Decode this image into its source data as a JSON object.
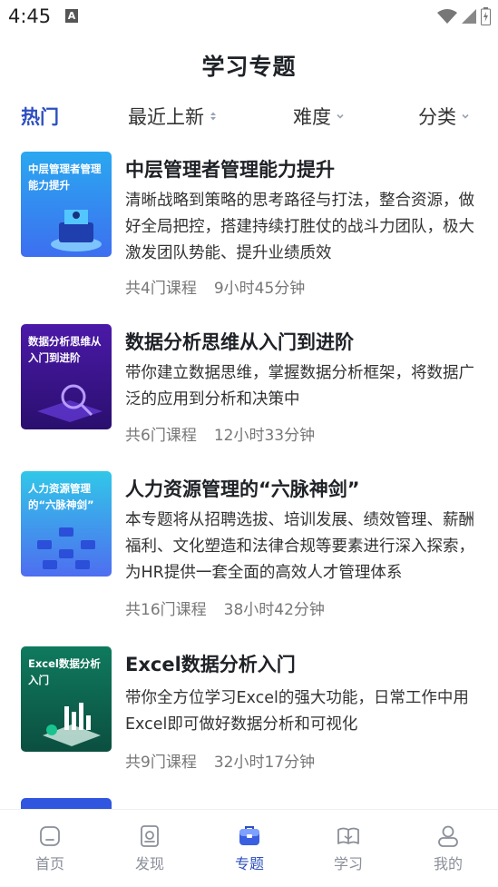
{
  "status_bar": {
    "time": "4:45",
    "notif_letter": "A"
  },
  "header": {
    "title": "学习专题"
  },
  "filters": [
    {
      "label": "热门",
      "active": true
    },
    {
      "label": "最近上新"
    },
    {
      "label": "难度"
    },
    {
      "label": "分类"
    }
  ],
  "courses": [
    {
      "thumb_text": "中层管理者管理能力提升",
      "title": "中层管理者管理能力提升",
      "desc": "清晰战略到策略的思考路径与打法，整合资源，做好全局把控，搭建持续打胜仗的战斗力团队，极大激发团队势能、提升业绩质效",
      "course_count": "共4门课程",
      "duration": "9小时45分钟"
    },
    {
      "thumb_text": "数据分析思维从入门到进阶",
      "title": "数据分析思维从入门到进阶",
      "desc": "带你建立数据思维，掌握数据分析框架，将数据广泛的应用到分析和决策中",
      "course_count": "共6门课程",
      "duration": "12小时33分钟"
    },
    {
      "thumb_text": "人力资源管理的“六脉神剑”",
      "title": "人力资源管理的“六脉神剑”",
      "desc": "本专题将从招聘选拔、培训发展、绩效管理、薪酬福利、文化塑造和法律合规等要素进行深入探索，为HR提供一套全面的高效人才管理体系",
      "course_count": "共16门课程",
      "duration": "38小时42分钟"
    },
    {
      "thumb_text": "Excel数据分析入门",
      "title": "Excel数据分析入门",
      "desc": "带你全方位学习Excel的强大功能，日常工作中用Excel即可做好数据分析和可视化",
      "course_count": "共9门课程",
      "duration": "32小时17分钟"
    }
  ],
  "nav": [
    {
      "label": "首页",
      "icon": "home-icon"
    },
    {
      "label": "发现",
      "icon": "discover-icon"
    },
    {
      "label": "专题",
      "icon": "topic-icon",
      "active": true
    },
    {
      "label": "学习",
      "icon": "book-icon"
    },
    {
      "label": "我的",
      "icon": "profile-icon"
    }
  ],
  "colors": {
    "accent": "#2d4fbf",
    "muted": "#8a8f99"
  }
}
